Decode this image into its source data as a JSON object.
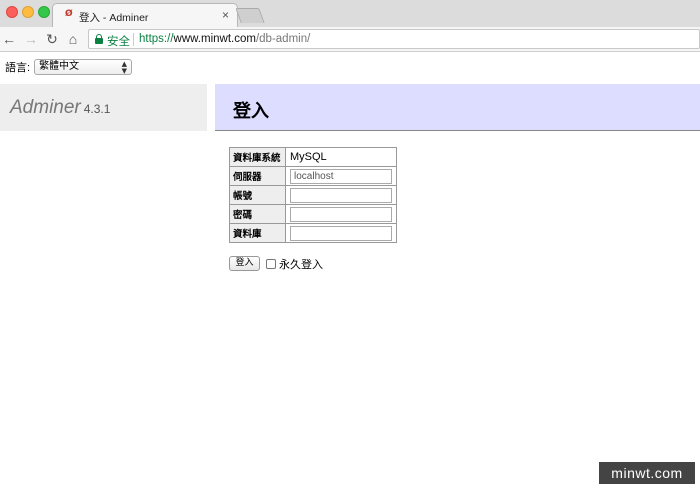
{
  "browser": {
    "tab_favicon": "Ø",
    "tab_title": "登入 - Adminer",
    "tab_close": "×",
    "secure_label": "安全",
    "url_scheme": "https://",
    "url_host": "www.minwt.com",
    "url_path": "/db-admin/",
    "icons": {
      "back": "←",
      "forward": "→",
      "reload": "↻",
      "home": "⌂"
    }
  },
  "language": {
    "label": "語言:",
    "selected": "繁體中文"
  },
  "menu": {
    "app_name": "Adminer",
    "version": "4.3.1"
  },
  "content": {
    "title": "登入"
  },
  "login_form": {
    "system_label": "資料庫系統",
    "system_value": "MySQL",
    "server_label": "伺服器",
    "server_value": "localhost",
    "username_label": "帳號",
    "username_value": "",
    "password_label": "密碼",
    "password_value": "",
    "database_label": "資料庫",
    "database_value": "",
    "submit_label": "登入",
    "remember_label": "永久登入"
  },
  "watermark": "minwt.com",
  "colors": {
    "content_header_bg": "#ddddff",
    "menu_header_bg": "#eeeeee",
    "secure_green": "#0b8043"
  }
}
